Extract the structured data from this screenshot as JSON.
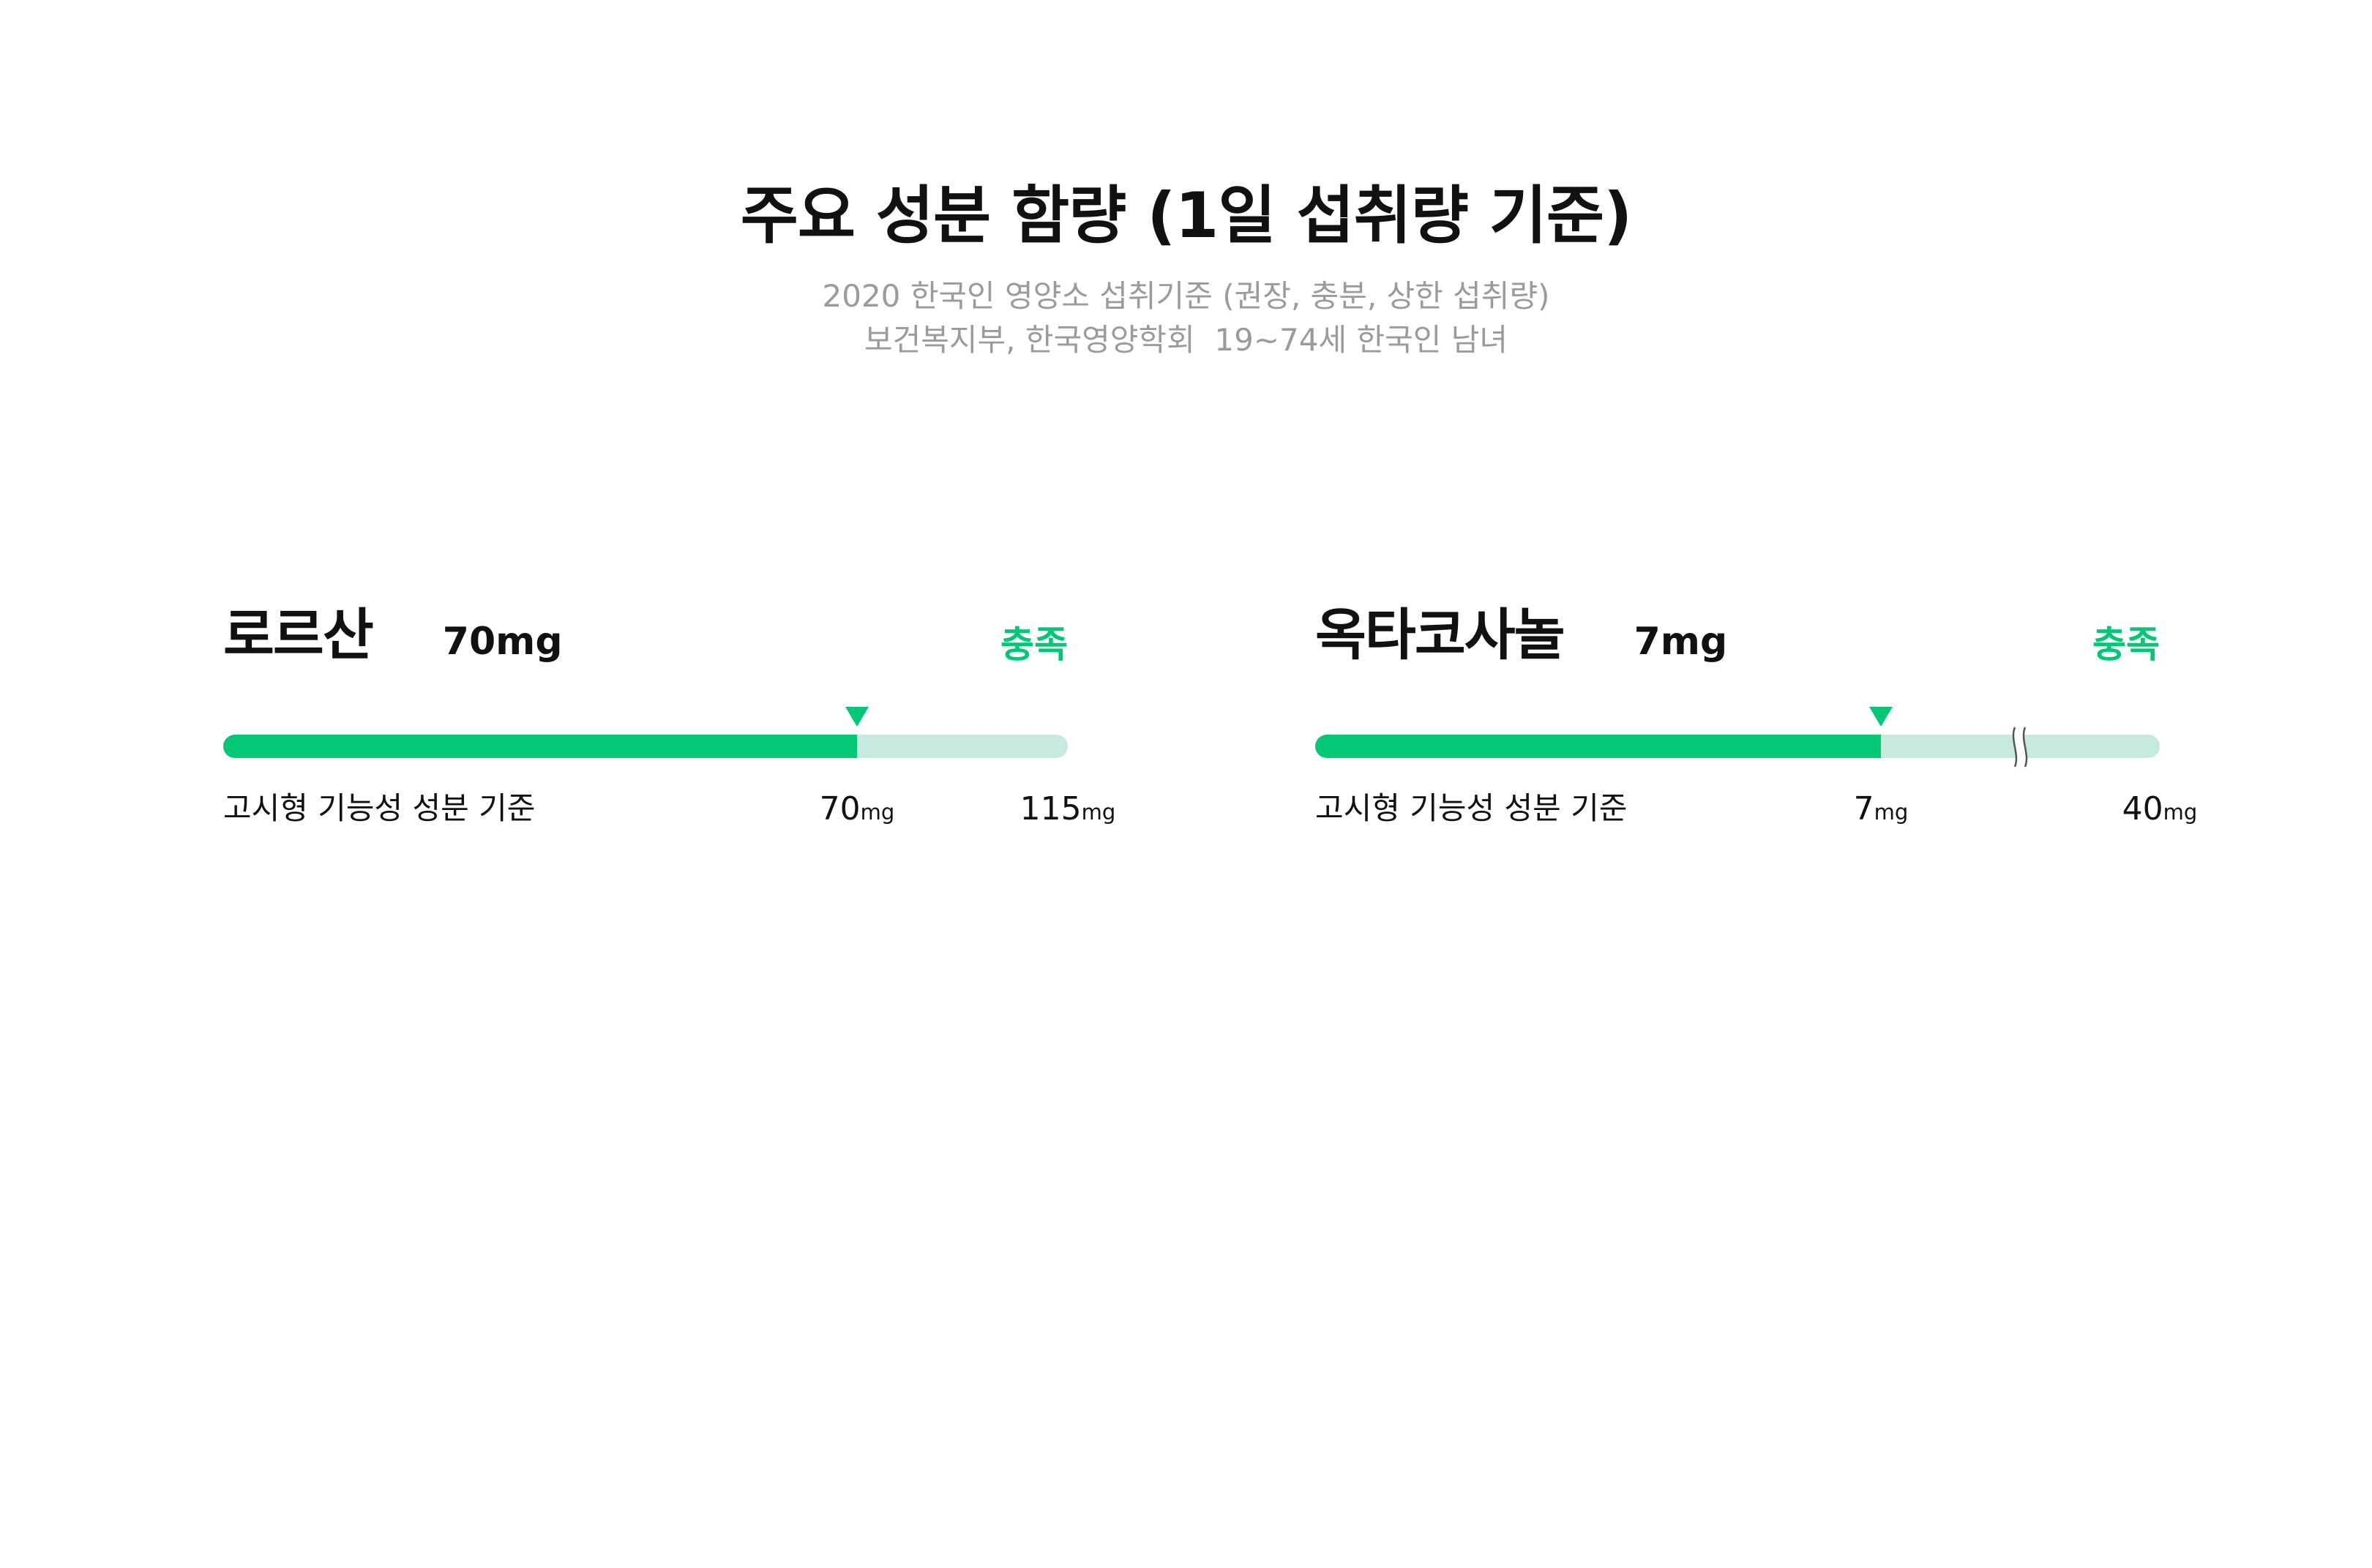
{
  "header": {
    "title": "주요 성분 함량 (1일 섭취량 기준)",
    "subtitle_lines": [
      "2020 한국인 영양소 섭취기준 (권장, 충분, 상한 섭취량)",
      "보건복지부, 한국영양학회  19~74세 한국인 남녀"
    ]
  },
  "colors": {
    "accent": "#03c775",
    "track": "#c6eadb",
    "text": "#111111",
    "muted": "#9b9b9b",
    "break_line": "#555555"
  },
  "chart_data": [
    {
      "type": "bar",
      "title": "로르산",
      "amount_label": "70mg",
      "status": "충족",
      "reference_label": "고시형 기능성 성분 기준",
      "value": 70,
      "max": 115,
      "unit": "mg",
      "fill_fraction": 0.75,
      "axis_break": false
    },
    {
      "type": "bar",
      "title": "옥타코사놀",
      "amount_label": "7mg",
      "status": "충족",
      "reference_label": "고시형 기능성 성분 기준",
      "value": 7,
      "max": 40,
      "unit": "mg",
      "fill_fraction": 0.67,
      "axis_break": true
    }
  ]
}
